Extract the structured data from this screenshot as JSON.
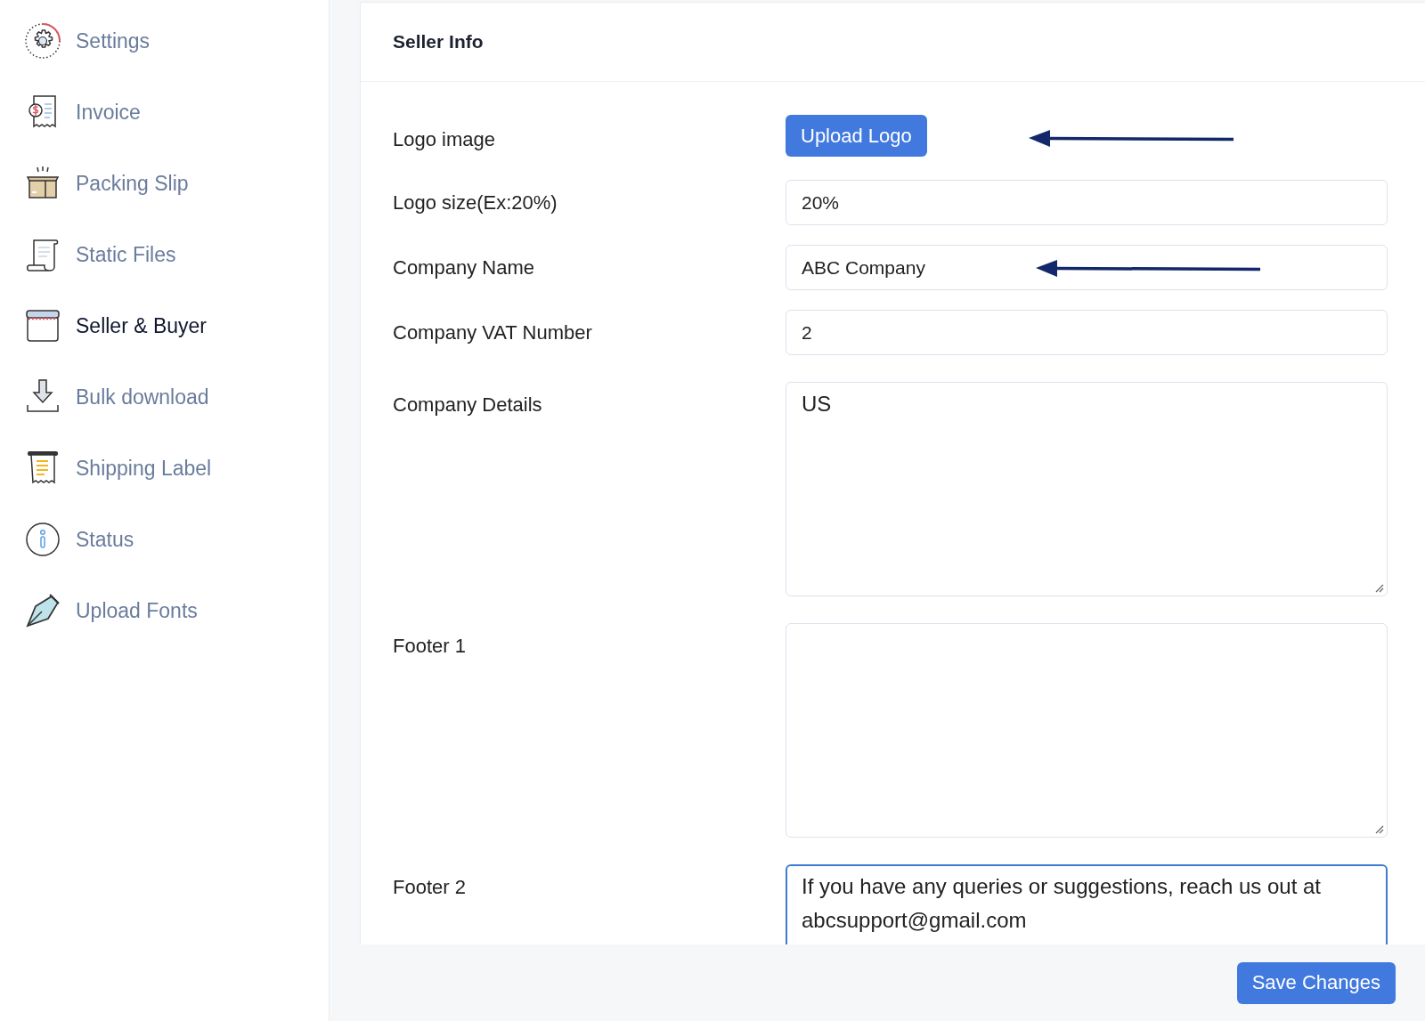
{
  "sidebar": {
    "items": [
      {
        "label": "Settings",
        "selected": false
      },
      {
        "label": "Invoice",
        "selected": false
      },
      {
        "label": "Packing Slip",
        "selected": false
      },
      {
        "label": "Static Files",
        "selected": false
      },
      {
        "label": "Seller & Buyer",
        "selected": true
      },
      {
        "label": "Bulk download",
        "selected": false
      },
      {
        "label": "Shipping Label",
        "selected": false
      },
      {
        "label": "Status",
        "selected": false
      },
      {
        "label": "Upload Fonts",
        "selected": false
      }
    ]
  },
  "panel": {
    "title": "Seller Info",
    "fields": [
      {
        "kind": "button",
        "label": "Logo image",
        "button": "Upload Logo",
        "annotated": true
      },
      {
        "kind": "text",
        "label": "Logo size(Ex:20%)",
        "value": "20%",
        "annotated": false
      },
      {
        "kind": "text",
        "label": "Company Name",
        "value": "ABC Company",
        "annotated": true
      },
      {
        "kind": "text",
        "label": "Company VAT Number",
        "value": "2",
        "annotated": false
      },
      {
        "kind": "textarea",
        "label": "Company Details",
        "value": "US",
        "focused": false
      },
      {
        "kind": "textarea",
        "label": "Footer 1",
        "focused": false
      },
      {
        "kind": "textarea",
        "label": "Footer 2",
        "value": "If you have any queries or suggestions, reach us out at abcsupport@gmail.com",
        "focused": true
      }
    ],
    "save_button": "Save Changes"
  }
}
